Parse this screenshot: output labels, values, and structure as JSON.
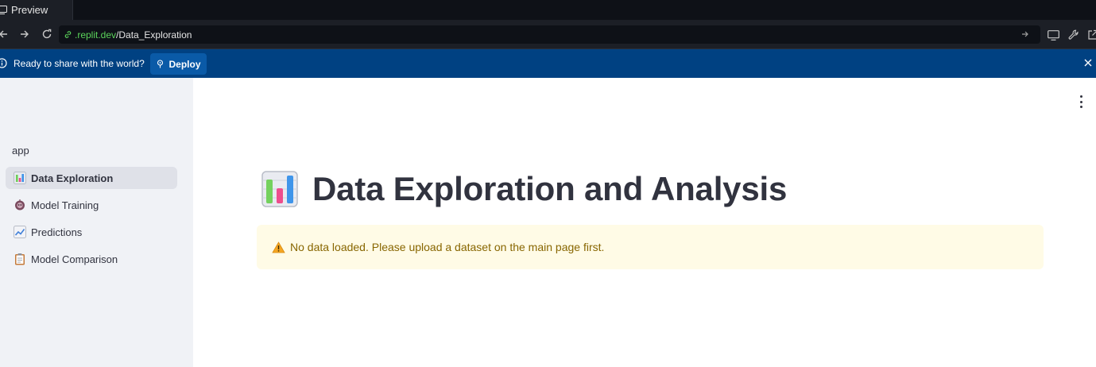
{
  "browser": {
    "tab_label": "Preview",
    "url_host": ".replit.dev",
    "url_path": "/Data_Exploration"
  },
  "banner": {
    "message": "Ready to share with the world?",
    "deploy_label": "Deploy"
  },
  "sidebar": {
    "app_label": "app",
    "items": [
      {
        "label": "Data Exploration",
        "icon": "bar-chart-emoji"
      },
      {
        "label": "Model Training",
        "icon": "robot-emoji"
      },
      {
        "label": "Predictions",
        "icon": "chart-increasing-emoji"
      },
      {
        "label": "Model Comparison",
        "icon": "clipboard-emoji"
      }
    ]
  },
  "main": {
    "title": "Data Exploration and Analysis",
    "title_icon": "bar-chart-emoji",
    "warning": "No data loaded. Please upload a dataset on the main page first.",
    "warning_icon": "warning-emoji"
  },
  "colors": {
    "banner_bg": "#004182",
    "sidebar_bg": "#f0f2f6",
    "warning_bg": "#fffbe6",
    "warning_text": "#886600",
    "url_host": "#5bd35b"
  }
}
